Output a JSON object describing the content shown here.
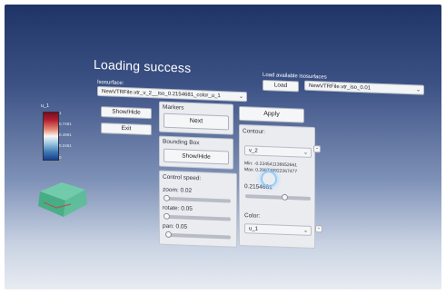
{
  "title": "Loading success",
  "isosurface": {
    "label": "Isosurface:",
    "selected": "NewVTRFile.vtr_v_2__iso_0.2154681_color_u_1"
  },
  "load_available": {
    "label": "Load available isosurfaces",
    "button": "Load",
    "selected": "NewVTRFile.vtr_iso_0.01"
  },
  "left_buttons": {
    "show_hide": "Show/Hide",
    "exit": "Exit"
  },
  "markers": {
    "label": "Markers",
    "next": "Next"
  },
  "apply": "Apply",
  "bounding_box": {
    "label": "Bounding Box",
    "show_hide": "Show/Hide"
  },
  "control_speed": {
    "label": "Control speed:",
    "zoom": "zoom: 0.02",
    "rotate": "rotate: 0.05",
    "pan": "pan: 0.05"
  },
  "contour": {
    "label": "Contour:",
    "variable": "v_2",
    "min": "Min: -0.234541138652661",
    "max": "Max: 0.298738922367477",
    "value": "0.2154681",
    "slider_position": 0.6,
    "color_label": "Color:",
    "color_variable": "u_1",
    "minus_label": "-"
  },
  "colorbar": {
    "title": "u_1",
    "ticks": [
      "1",
      "0.7461",
      "0.4961",
      "0.2461",
      "0"
    ],
    "colors": [
      "#7a0c1c",
      "#f7f7f7",
      "#1b3f8f"
    ]
  },
  "icons": {
    "chevron": "chevron-down-icon"
  }
}
